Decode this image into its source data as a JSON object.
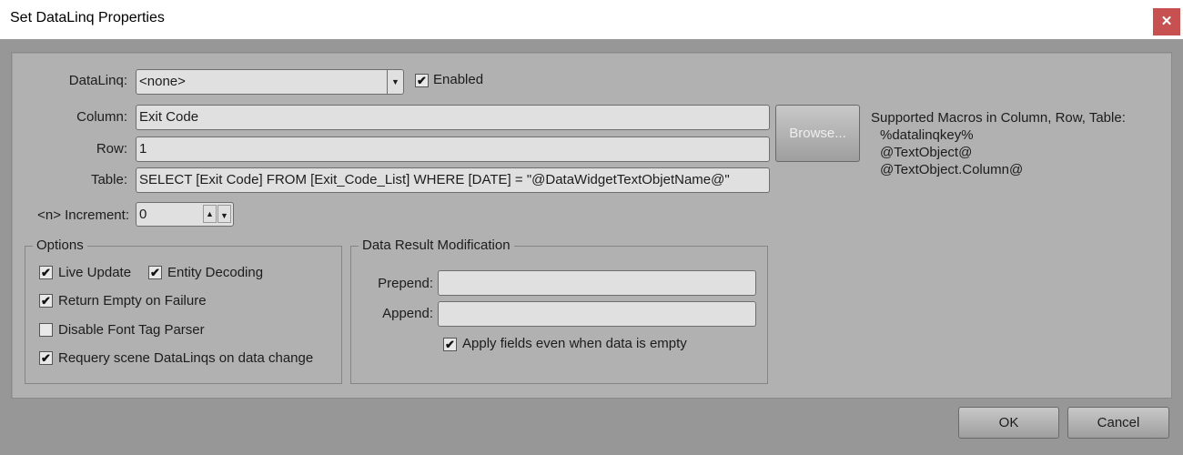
{
  "window": {
    "title": "Set DataLinq Properties",
    "close_icon": "close-icon"
  },
  "fields": {
    "datalinq_label": "DataLinq:",
    "datalinq_value": "<none>",
    "enabled_label": "Enabled",
    "enabled_checked": true,
    "column_label": "Column:",
    "column_value": "Exit Code",
    "row_label": "Row:",
    "row_value": "1",
    "table_label": "Table:",
    "table_value": "SELECT [Exit Code] FROM [Exit_Code_List] WHERE [DATE] = \"@DataWidgetTextObjetName@\"",
    "increment_label": "<n> Increment:",
    "increment_value": "0",
    "browse_label": "Browse..."
  },
  "macros": {
    "heading": "Supported Macros in Column, Row, Table:",
    "items": [
      "%datalinqkey%",
      "@TextObject@",
      "@TextObject.Column@"
    ]
  },
  "options": {
    "legend": "Options",
    "items": [
      {
        "label": "Live Update",
        "checked": true
      },
      {
        "label": "Entity Decoding",
        "checked": true
      },
      {
        "label": "Return Empty on Failure",
        "checked": true
      },
      {
        "label": "Disable Font Tag Parser",
        "checked": false
      },
      {
        "label": "Requery scene DataLinqs on data change",
        "checked": true
      }
    ]
  },
  "result_mod": {
    "legend": "Data Result Modification",
    "prepend_label": "Prepend:",
    "prepend_value": "",
    "append_label": "Append:",
    "append_value": "",
    "apply_label": "Apply fields even when data is empty",
    "apply_checked": true
  },
  "buttons": {
    "ok": "OK",
    "cancel": "Cancel"
  }
}
